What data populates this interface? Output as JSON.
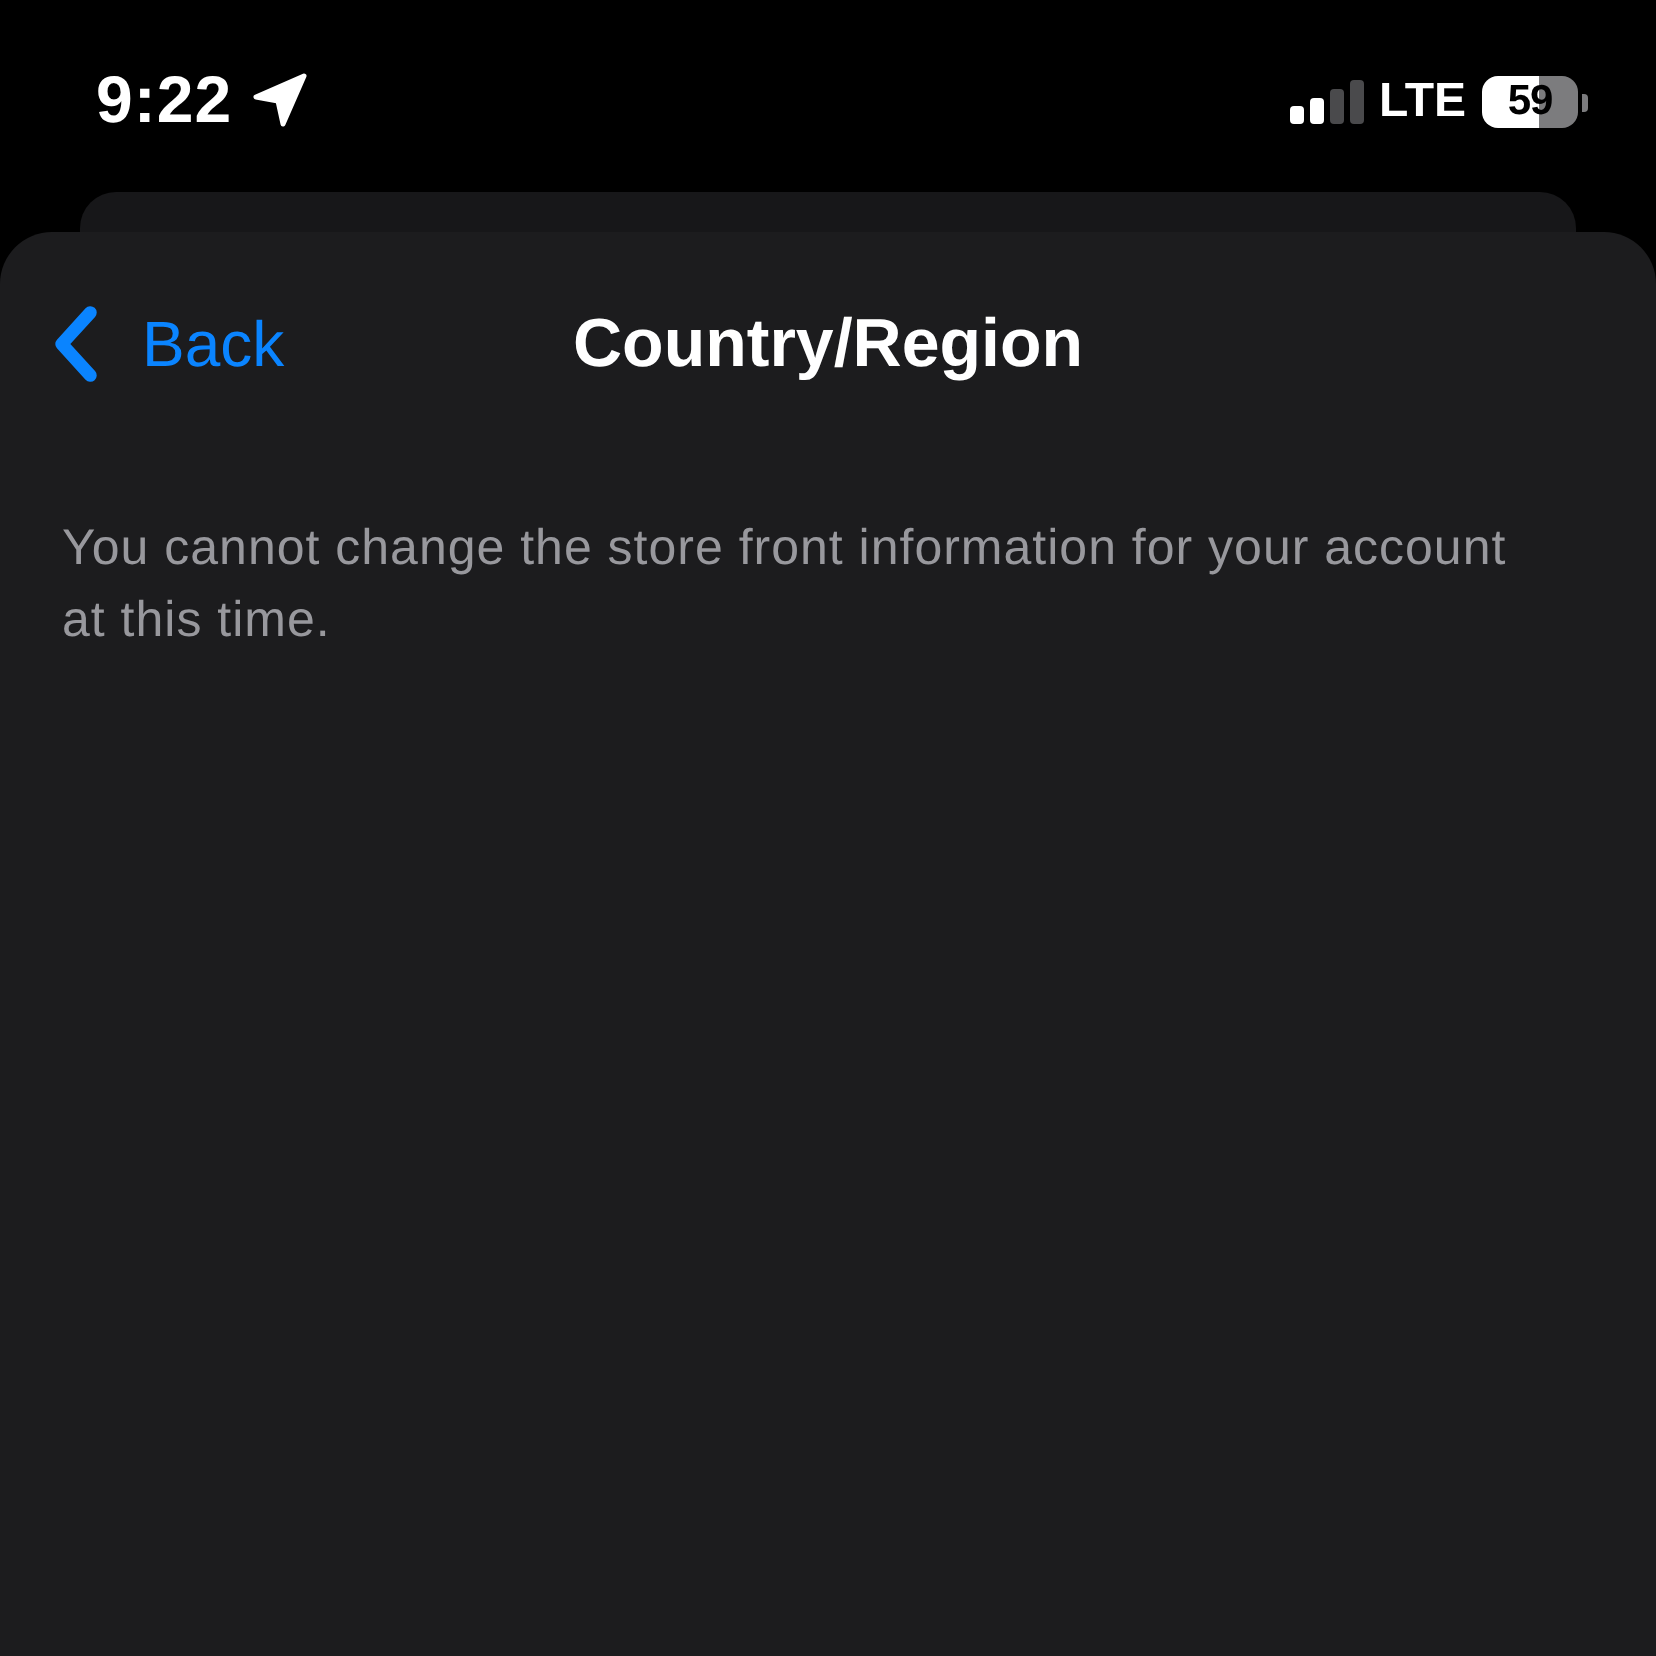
{
  "status_bar": {
    "time": "9:22",
    "network": "LTE",
    "battery": "59"
  },
  "nav_bar": {
    "back_label": "Back",
    "title": "Country/Region"
  },
  "message": "You cannot change the store front information for your account at this time."
}
